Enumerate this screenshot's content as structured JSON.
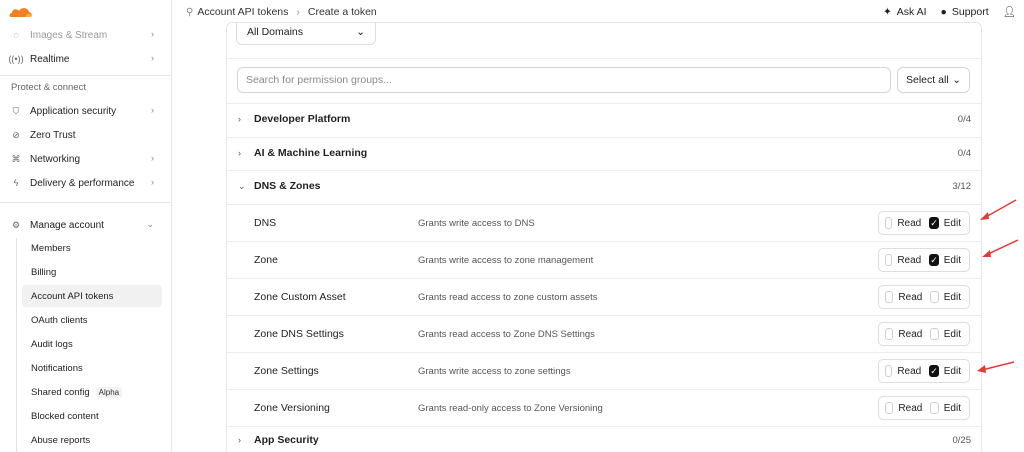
{
  "sidebar": {
    "top_faded": "Images & Stream",
    "realtime": "Realtime",
    "section_label": "Protect & connect",
    "protect_items": [
      "Application security",
      "Zero Trust",
      "Networking",
      "Delivery & performance"
    ],
    "manage_account": "Manage account",
    "sub_items": [
      "Members",
      "Billing",
      "Account API tokens",
      "OAuth clients",
      "Audit logs",
      "Notifications",
      "Shared config",
      "Blocked content",
      "Abuse reports"
    ],
    "shared_config_badge": "Alpha",
    "active_item": "Account API tokens"
  },
  "topbar": {
    "crumb1": "Account API tokens",
    "crumb2": "Create a token",
    "ask_ai": "Ask AI",
    "support": "Support"
  },
  "main": {
    "domains_value": "All Domains",
    "search_placeholder": "Search for permission groups...",
    "select_all": "Select all",
    "groups": [
      {
        "name": "Developer Platform",
        "count": "0/4"
      },
      {
        "name": "AI & Machine Learning",
        "count": "0/4"
      },
      {
        "name": "DNS & Zones",
        "count": "3/12"
      },
      {
        "name": "App Security",
        "count": "0/25"
      }
    ],
    "read_label": "Read",
    "edit_label": "Edit",
    "permissions": [
      {
        "name": "DNS",
        "desc": "Grants write access to DNS",
        "read": false,
        "edit": true
      },
      {
        "name": "Zone",
        "desc": "Grants write access to zone management",
        "read": false,
        "edit": true
      },
      {
        "name": "Zone Custom Asset",
        "desc": "Grants read access to zone custom assets",
        "read": false,
        "edit": false
      },
      {
        "name": "Zone DNS Settings",
        "desc": "Grants read access to Zone DNS Settings",
        "read": false,
        "edit": false
      },
      {
        "name": "Zone Settings",
        "desc": "Grants write access to zone settings",
        "read": false,
        "edit": true
      },
      {
        "name": "Zone Versioning",
        "desc": "Grants read-only access to Zone Versioning",
        "read": false,
        "edit": false
      }
    ]
  },
  "colors": {
    "brand_orange": "#f38020",
    "annotation_red": "#e53935",
    "checked": "#111111"
  }
}
